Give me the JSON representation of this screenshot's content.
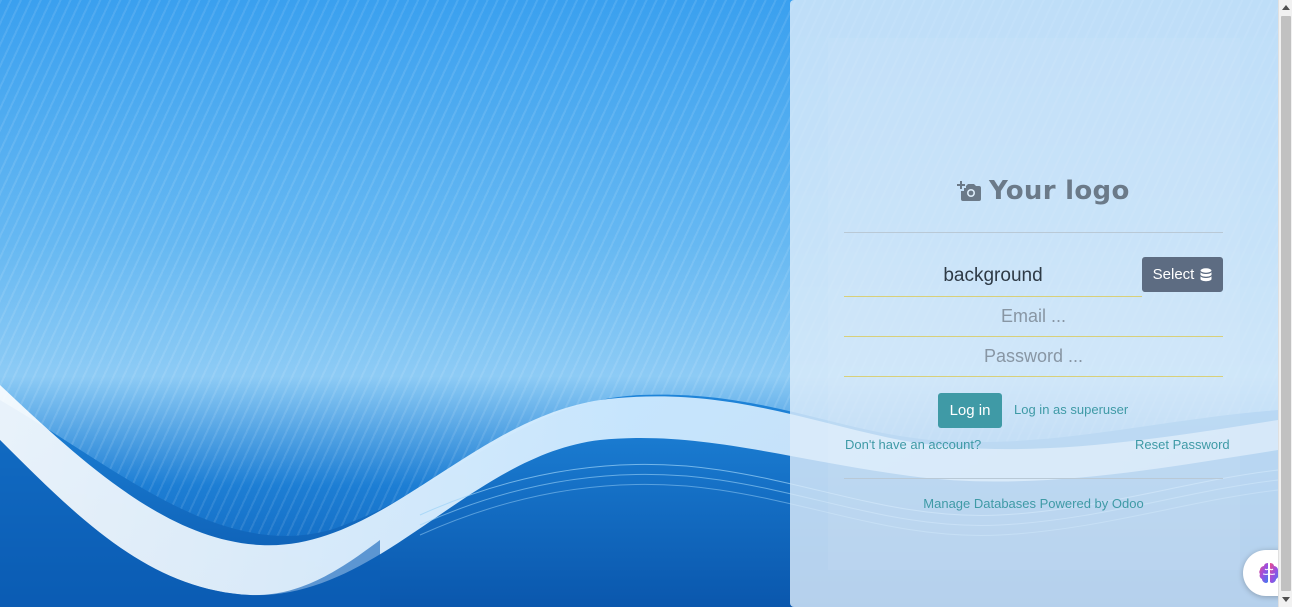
{
  "logo": {
    "text": "Your logo",
    "icon": "add-photo-icon"
  },
  "database": {
    "value": "background",
    "select_label": "Select",
    "select_icon": "database-icon"
  },
  "login_form": {
    "email_placeholder": "Email ...",
    "password_placeholder": "Password ..."
  },
  "actions": {
    "login_label": "Log in",
    "superuser_label": "Log in as superuser",
    "signup_label": "Don't have an account?",
    "reset_label": "Reset Password"
  },
  "footer": {
    "text": "Manage Databases Powered by Odoo"
  },
  "chat_widget": {
    "icon": "brain-icon"
  },
  "colors": {
    "accent": "#3f9aa6",
    "select_button": "#5d6c82",
    "field_underline": "#d8d07a",
    "logo": "#6b7a89"
  }
}
